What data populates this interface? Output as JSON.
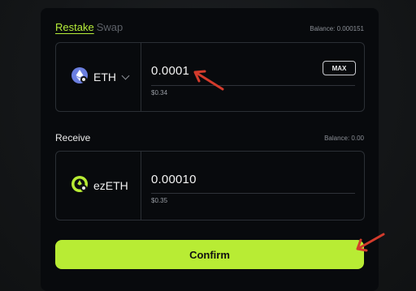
{
  "tabs": {
    "active": "Restake",
    "inactive": "Swap"
  },
  "restake": {
    "balance": "Balance: 0.000151",
    "token": "ETH",
    "amount": "0.0001",
    "usd": "$0.34",
    "max_label": "MAX"
  },
  "receive": {
    "label": "Receive",
    "balance": "Balance: 0.00",
    "token": "ezETH",
    "amount": "0.00010",
    "usd": "$0.35"
  },
  "confirm_label": "Confirm",
  "colors": {
    "accent": "#b8ec34",
    "eth_icon": "#6b7fe0",
    "arrow": "#d33b2c"
  },
  "icons": {
    "from_token": "eth-icon",
    "to_token": "ezeth-icon",
    "dropdown": "chevron-down-icon"
  }
}
